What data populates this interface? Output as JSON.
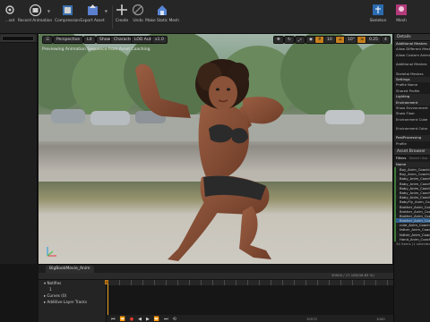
{
  "toolbar": {
    "items": [
      {
        "label": "...set",
        "icon": "gear-icon"
      },
      {
        "label": "Record Animation",
        "icon": "record-animation-icon"
      },
      {
        "label": "Compression",
        "icon": "compression-icon"
      },
      {
        "label": "Export Asset",
        "icon": "export-asset-icon"
      },
      {
        "label": "Create",
        "icon": "plus-icon"
      },
      {
        "label": "Undo",
        "icon": "undo-icon"
      },
      {
        "label": "Make Static Mesh",
        "icon": "static-mesh-icon"
      },
      {
        "label": "Skeleton",
        "icon": "skeleton-icon"
      },
      {
        "label": "Mesh",
        "icon": "mesh-icon"
      }
    ]
  },
  "viewport": {
    "buttons": {
      "perspective": "Perspective",
      "lit": "Lit",
      "show": "Show",
      "character": "Character",
      "lod": "LOD Auto",
      "speed": "x1.0",
      "snap_grid": "10",
      "snap_rot": "10°",
      "snap_scale": "0.25",
      "cam_speed": "4"
    },
    "info_text": "Previewing Animation Sequence from Asset Coaching"
  },
  "details": {
    "tab": "Details",
    "rows": [
      {
        "type": "section",
        "text": "Additional Meshes"
      },
      {
        "type": "row",
        "text": "Allow Different Mesh"
      },
      {
        "type": "row",
        "text": "Allow Custom Animation"
      },
      {
        "type": "spacer"
      },
      {
        "type": "row",
        "text": "Additional Meshes"
      },
      {
        "type": "spacer"
      },
      {
        "type": "row",
        "text": "Skeletal Meshes"
      },
      {
        "type": "section",
        "text": "Settings"
      },
      {
        "type": "row",
        "text": "Profile Name"
      },
      {
        "type": "row",
        "text": "Shared Profile"
      },
      {
        "type": "section",
        "text": "Lighting"
      },
      {
        "type": "section",
        "text": "Environment"
      },
      {
        "type": "row",
        "text": "Show Environment"
      },
      {
        "type": "row",
        "text": "Show Floor"
      },
      {
        "type": "row",
        "text": "Environment Cube"
      },
      {
        "type": "spacer"
      },
      {
        "type": "row",
        "text": "Environment Color"
      },
      {
        "type": "spacer"
      },
      {
        "type": "section",
        "text": "PostProcessing"
      },
      {
        "type": "row",
        "text": "Profile"
      }
    ]
  },
  "asset_browser": {
    "tab": "Asset Browser",
    "filter_label": "Filters",
    "search_placeholder": "Search Ass",
    "column_name": "Name",
    "items": [
      "Boy_Anim_Coaching",
      "Boy_Anim_Coaching2",
      "Baby_Anim_Coaching",
      "Baby_Anim_Coaching2",
      "Baby_Anim_Coaching3",
      "Baby_Anim_Coaching4",
      "Baby_Anim_Coaching5",
      "BabyFly_Anim_Coaching",
      "Brother_Anim_Coaching",
      "Brother_Anim_Coaching2",
      "Brother_Anim_Coaching3",
      "Brother_Anim_Coaching4",
      "cute_Anim_Coaching",
      "father_Anim_Coaching",
      "father_Anim_Coaching2",
      "Hand_Anim_Coaching"
    ],
    "status": "34 items (1 selected)"
  },
  "sequencer": {
    "tab": "BigBookMovie_Anim",
    "tracks": [
      "Notifies",
      "1",
      "Curves (0)",
      "Additive Layer Tracks"
    ],
    "playhead_frame": "0",
    "right_readout": "30000 / 17.185(06.83 %)",
    "end_frame": "10572",
    "range_end": "1000"
  }
}
